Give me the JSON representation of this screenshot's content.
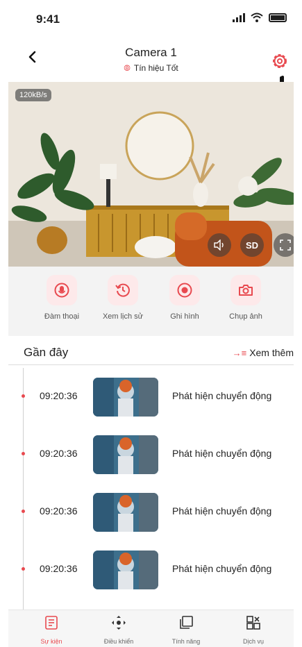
{
  "status_bar": {
    "time": "9:41"
  },
  "header": {
    "title": "Camera 1",
    "signal_text": "Tín hiệu Tốt"
  },
  "camera": {
    "speed": "120kB/s",
    "quality_label": "SD"
  },
  "actions": [
    {
      "label": "Đàm thoại",
      "icon": "microphone-icon"
    },
    {
      "label": "Xem lịch sử",
      "icon": "history-icon"
    },
    {
      "label": "Ghi hình",
      "icon": "record-icon"
    },
    {
      "label": "Chụp ảnh",
      "icon": "camera-icon"
    }
  ],
  "recent": {
    "title": "Gần đây",
    "see_more": "Xem thêm"
  },
  "events": [
    {
      "time": "09:20:36",
      "desc": "Phát hiện chuyển động"
    },
    {
      "time": "09:20:36",
      "desc": "Phát hiện chuyển động"
    },
    {
      "time": "09:20:36",
      "desc": "Phát hiện chuyển động"
    },
    {
      "time": "09:20:36",
      "desc": "Phát hiện chuyển động"
    }
  ],
  "bottom_nav": [
    {
      "label": "Sự kiện",
      "active": true
    },
    {
      "label": "Điều khiển",
      "active": false
    },
    {
      "label": "Tính năng",
      "active": false
    },
    {
      "label": "Dịch vụ",
      "active": false
    }
  ],
  "colors": {
    "accent": "#e8494f",
    "panel": "#f3f3f3"
  }
}
